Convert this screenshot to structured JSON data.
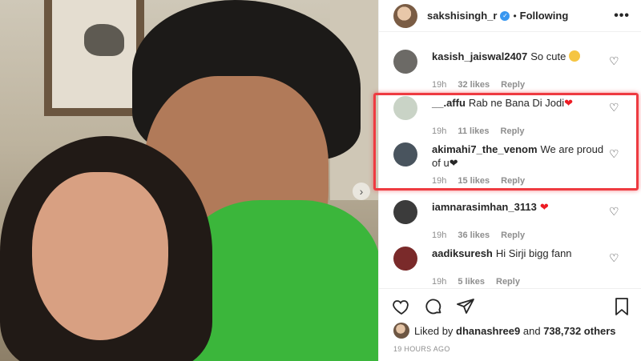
{
  "post": {
    "username": "sakshisingh_r",
    "separator": "•",
    "follow_status": "Following",
    "more": "•••"
  },
  "photo": {
    "next_arrow": "›"
  },
  "comments": [
    {
      "author": "kasish_jaiswal2407",
      "text": "So cute",
      "emoji": "face",
      "age": "19h",
      "likes": "32 likes",
      "reply": "Reply",
      "avatar_color": "#6c6a66"
    },
    {
      "author": "__.affu",
      "text": "Rab ne Bana Di Jodi",
      "emoji": "heart",
      "age": "19h",
      "likes": "11 likes",
      "reply": "Reply",
      "avatar_color": "#c9d3c6"
    },
    {
      "author": "akimahi7_the_venom",
      "text": "We are proud of u",
      "emoji": "heart-black",
      "age": "19h",
      "likes": "15 likes",
      "reply": "Reply",
      "avatar_color": "#49545e"
    },
    {
      "author": "iamnarasimhan_3113",
      "text": "",
      "emoji": "heart",
      "age": "19h",
      "likes": "36 likes",
      "reply": "Reply",
      "avatar_color": "#3b3b3b"
    },
    {
      "author": "aadiksuresh",
      "text": "Hi Sirji bigg fann",
      "emoji": "",
      "age": "19h",
      "likes": "5 likes",
      "reply": "Reply",
      "avatar_color": "#7a2a2a"
    }
  ],
  "icons": {
    "comment_like": "heart-outline-icon",
    "like": "heart-icon",
    "comment": "comment-icon",
    "share": "send-icon",
    "save": "bookmark-icon"
  },
  "likes": {
    "prefix": "Liked by",
    "user": "dhanashree9",
    "conjunction": "and",
    "others": "738,732 others"
  },
  "timestamp": "19 HOURS AGO",
  "colors": {
    "verified": "#3897f0",
    "highlight": "#ee3b41",
    "shirt": "#3bb63b"
  }
}
